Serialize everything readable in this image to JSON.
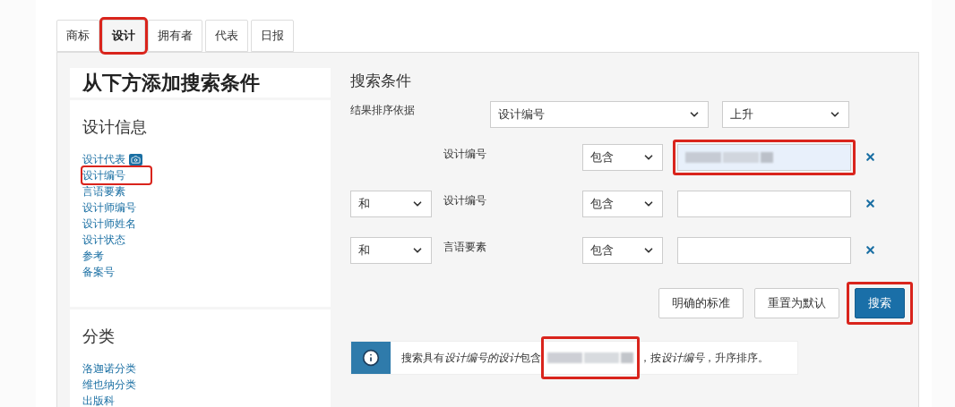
{
  "tabs": [
    {
      "label": "商标",
      "selected": false,
      "highlighted": false
    },
    {
      "label": "设计",
      "selected": true,
      "highlighted": true
    },
    {
      "label": "拥有者",
      "selected": false,
      "highlighted": false
    },
    {
      "label": "代表",
      "selected": false,
      "highlighted": false
    },
    {
      "label": "日报",
      "selected": false,
      "highlighted": false
    }
  ],
  "sidebar": {
    "title": "从下方添加搜索条件",
    "sections": [
      {
        "title": "设计信息",
        "items": [
          {
            "label": "设计代表",
            "kind": "camera",
            "highlighted": false
          },
          {
            "label": "设计编号",
            "kind": "plain",
            "highlighted": true
          },
          {
            "label": "言语要素",
            "kind": "plain",
            "highlighted": false
          },
          {
            "label": "设计师编号",
            "kind": "plain",
            "highlighted": false
          },
          {
            "label": "设计师姓名",
            "kind": "plain",
            "highlighted": false
          },
          {
            "label": "设计状态",
            "kind": "plain",
            "highlighted": false
          },
          {
            "label": "参考",
            "kind": "plain",
            "highlighted": false
          },
          {
            "label": "备案号",
            "kind": "plain",
            "highlighted": false
          }
        ]
      },
      {
        "title": "分类",
        "items": [
          {
            "label": "洛迦诺分类",
            "kind": "plain",
            "highlighted": false
          },
          {
            "label": "维也纳分类",
            "kind": "plain",
            "highlighted": false
          },
          {
            "label": "出版科",
            "kind": "plain",
            "highlighted": false
          }
        ]
      }
    ]
  },
  "criteria": {
    "heading": "搜索条件",
    "sort": {
      "label": "结果排序依据",
      "field": "设计编号",
      "order": "上升"
    },
    "rows": [
      {
        "field_label": "设计编号",
        "operator": "包含",
        "value_blurred": true,
        "highlighted": true
      },
      {
        "conjunction": "和",
        "field_label": "设计编号",
        "operator": "包含",
        "value_blurred": false,
        "highlighted": false
      },
      {
        "conjunction": "和",
        "field_label": "言语要素",
        "operator": "包含",
        "value_blurred": false,
        "highlighted": false
      }
    ],
    "buttons": [
      {
        "label": "明确的标准",
        "kind": "default",
        "highlighted": false
      },
      {
        "label": "重置为默认",
        "kind": "default",
        "highlighted": false
      },
      {
        "label": "搜索",
        "kind": "primary",
        "highlighted": true
      }
    ],
    "info": {
      "text_before": [
        {
          "text": "搜索具有",
          "italic": false
        },
        {
          "text": "设计编号的设计",
          "italic": true
        },
        {
          "text": "包含",
          "italic": false
        }
      ],
      "value_blurred": true,
      "highlighted": true,
      "text_after": [
        {
          "text": "，按",
          "italic": false
        },
        {
          "text": "设计编号",
          "italic": true
        },
        {
          "text": "，升序排序。",
          "italic": false
        }
      ]
    }
  }
}
